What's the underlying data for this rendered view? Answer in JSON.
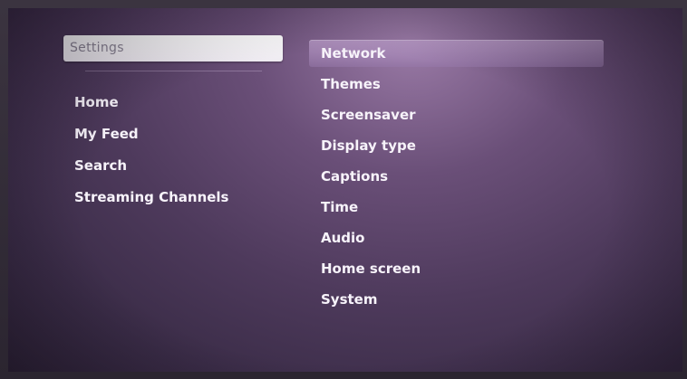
{
  "settings_header": {
    "label": "Settings"
  },
  "left_menu": {
    "items": [
      {
        "label": "Home"
      },
      {
        "label": "My Feed"
      },
      {
        "label": "Search"
      },
      {
        "label": "Streaming Channels"
      }
    ]
  },
  "settings_menu": {
    "selected_index": 0,
    "items": [
      {
        "label": "Network"
      },
      {
        "label": "Themes"
      },
      {
        "label": "Screensaver"
      },
      {
        "label": "Display type"
      },
      {
        "label": "Captions"
      },
      {
        "label": "Time"
      },
      {
        "label": "Audio"
      },
      {
        "label": "Home screen"
      },
      {
        "label": "System"
      }
    ]
  },
  "colors": {
    "background": "#4e3a5c",
    "highlight": "#a888b8",
    "text": "#f7f3fa"
  }
}
